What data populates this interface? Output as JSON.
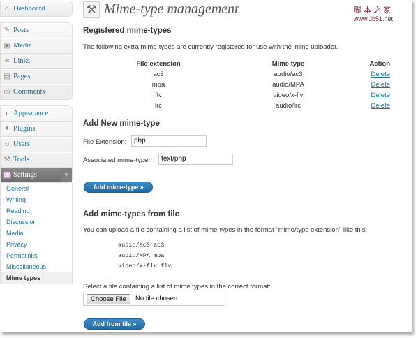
{
  "sidebar": {
    "group1": [
      {
        "label": "Dashboard",
        "icon": "dashboard-icon"
      }
    ],
    "group2": [
      {
        "label": "Posts",
        "icon": "pin-icon"
      },
      {
        "label": "Media",
        "icon": "media-icon"
      },
      {
        "label": "Links",
        "icon": "link-icon"
      },
      {
        "label": "Pages",
        "icon": "page-icon"
      },
      {
        "label": "Comments",
        "icon": "comment-icon"
      }
    ],
    "group3": [
      {
        "label": "Appearance",
        "icon": "appearance-icon"
      },
      {
        "label": "Plugins",
        "icon": "plugin-icon"
      },
      {
        "label": "Users",
        "icon": "users-icon"
      },
      {
        "label": "Tools",
        "icon": "tools-icon"
      },
      {
        "label": "Settings",
        "icon": "settings-icon"
      }
    ],
    "submenu": [
      "General",
      "Writing",
      "Reading",
      "Discussion",
      "Media",
      "Privacy",
      "Permalinks",
      "Miscellaneous",
      "Mime types"
    ]
  },
  "page": {
    "title": "Mime-type management",
    "registered_heading": "Registered mime-types",
    "registered_desc": "The following extra mime-types are currently registered for use with the inline uploader.",
    "table": {
      "headers": [
        "File extension",
        "Mime type",
        "Action"
      ],
      "rows": [
        {
          "ext": "ac3",
          "mime": "audio/ac3",
          "action": "Delete"
        },
        {
          "ext": "mpa",
          "mime": "audio/MPA",
          "action": "Delete"
        },
        {
          "ext": "flv",
          "mime": "video/x-flv",
          "action": "Delete"
        },
        {
          "ext": "lrc",
          "mime": "audio/lrc",
          "action": "Delete"
        }
      ]
    },
    "add_heading": "Add New mime-type",
    "ext_label": "File Extension:",
    "ext_value": "php",
    "mime_label": "Associated mime-type:",
    "mime_value": "text/php",
    "add_button": "Add mime-type »",
    "file_heading": "Add mime-types from file",
    "file_desc": "You can upload a file containing a list of mime-types in the format \"mime/type extension\" like this:",
    "example": "audio/ac3 ac3\naudio/MPA mpa\nvideo/x-flv flv",
    "select_label": "Select a file containing a list of mime types in the correct format:",
    "choose_button": "Choose File",
    "no_file": "No file chosen",
    "file_button": "Add from file »"
  },
  "watermark": {
    "cn": "脚本之家",
    "url": "www.Jb51.net"
  }
}
